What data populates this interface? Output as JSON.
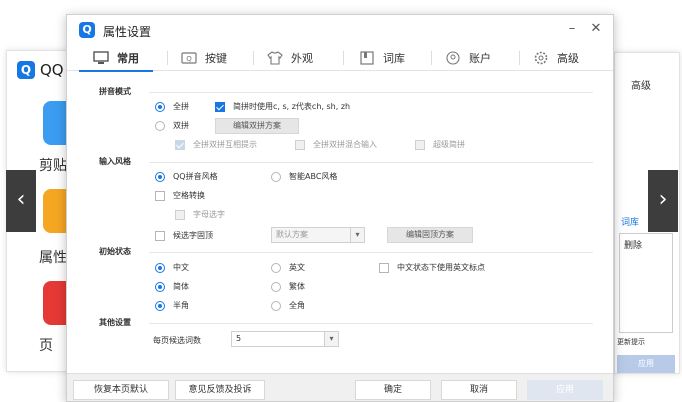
{
  "background": {
    "left_title": "QQ",
    "left_logo": "Q",
    "left_apps": [
      "剪贴",
      "属性",
      "页"
    ],
    "right_labels": [
      "高级",
      "词库",
      "删除",
      "更新提示"
    ],
    "right_button": "应用"
  },
  "nav": {
    "prev_icon": "‹",
    "next_icon": "›"
  },
  "dialog": {
    "logo": "Q",
    "title": "属性设置",
    "minimize": "–",
    "close": "✕",
    "tabs": [
      {
        "label": "常用",
        "icon": "monitor-icon"
      },
      {
        "label": "按键",
        "icon": "keyboard-icon"
      },
      {
        "label": "外观",
        "icon": "tshirt-icon"
      },
      {
        "label": "词库",
        "icon": "book-icon"
      },
      {
        "label": "账户",
        "icon": "user-icon"
      },
      {
        "label": "高级",
        "icon": "gear-icon"
      }
    ],
    "active_tab": "常用",
    "sections": {
      "pinyin": {
        "label": "拼音模式",
        "full": "全拼",
        "jianpin": "简拼时使用c, s, z代表ch, sh, zh",
        "shuangpin": "双拼",
        "edit_shuangpin": "编辑双拼方案",
        "sp_mutual": "全拼双拼互相提示",
        "sp_mix": "全拼双拼混合输入",
        "super_jianpin": "超级简拼"
      },
      "style": {
        "label": "输入风格",
        "qq_style": "QQ拼音风格",
        "abc_style": "智能ABC风格",
        "space_convert": "空格转换",
        "letter_select": "字母选字",
        "candidate_pin": "候选字固顶",
        "scheme_select": "默认方案",
        "edit_pin": "编辑固顶方案"
      },
      "init": {
        "label": "初始状态",
        "chinese": "中文",
        "english": "英文",
        "cn_en_punct": "中文状态下使用英文标点",
        "simplified": "简体",
        "traditional": "繁体",
        "half": "半角",
        "full_width": "全角"
      },
      "other": {
        "label": "其他设置",
        "per_page": "每页候选词数",
        "per_page_value": "5"
      }
    },
    "footer": {
      "restore": "恢复本页默认",
      "feedback": "意见反馈及投诉",
      "ok": "确定",
      "cancel": "取消",
      "apply": "应用"
    },
    "colors": {
      "accent": "#1677e5",
      "disabled_button": "#dfe6f0"
    }
  }
}
